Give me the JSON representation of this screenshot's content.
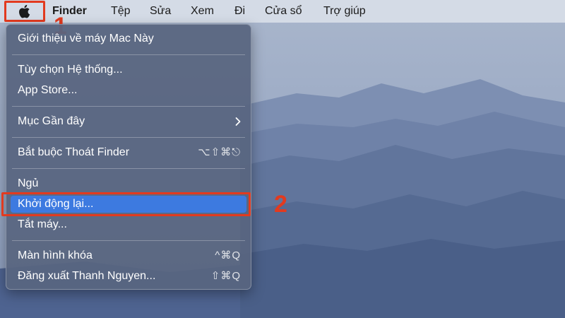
{
  "menubar": {
    "apple_icon": "apple-logo",
    "items": [
      "Finder",
      "Tệp",
      "Sửa",
      "Xem",
      "Đi",
      "Cửa sổ",
      "Trợ giúp"
    ]
  },
  "apple_menu": {
    "about": "Giới thiệu về máy Mac Này",
    "system_prefs": "Tùy chọn Hệ thống...",
    "app_store": "App Store...",
    "recent_items": "Mục Gần đây",
    "force_quit": {
      "label": "Bắt buộc Thoát Finder",
      "shortcut": "⌥⇧⌘⎋"
    },
    "sleep": "Ngủ",
    "restart": "Khởi động lại...",
    "shutdown": "Tắt máy...",
    "lock_screen": {
      "label": "Màn hình khóa",
      "shortcut": "^⌘Q"
    },
    "logout": {
      "label": "Đăng xuất Thanh Nguyen...",
      "shortcut": "⇧⌘Q"
    }
  },
  "annotations": {
    "step1": "1",
    "step2": "2"
  },
  "colors": {
    "highlight": "#e23a1f",
    "selected": "#3d7ae0"
  }
}
